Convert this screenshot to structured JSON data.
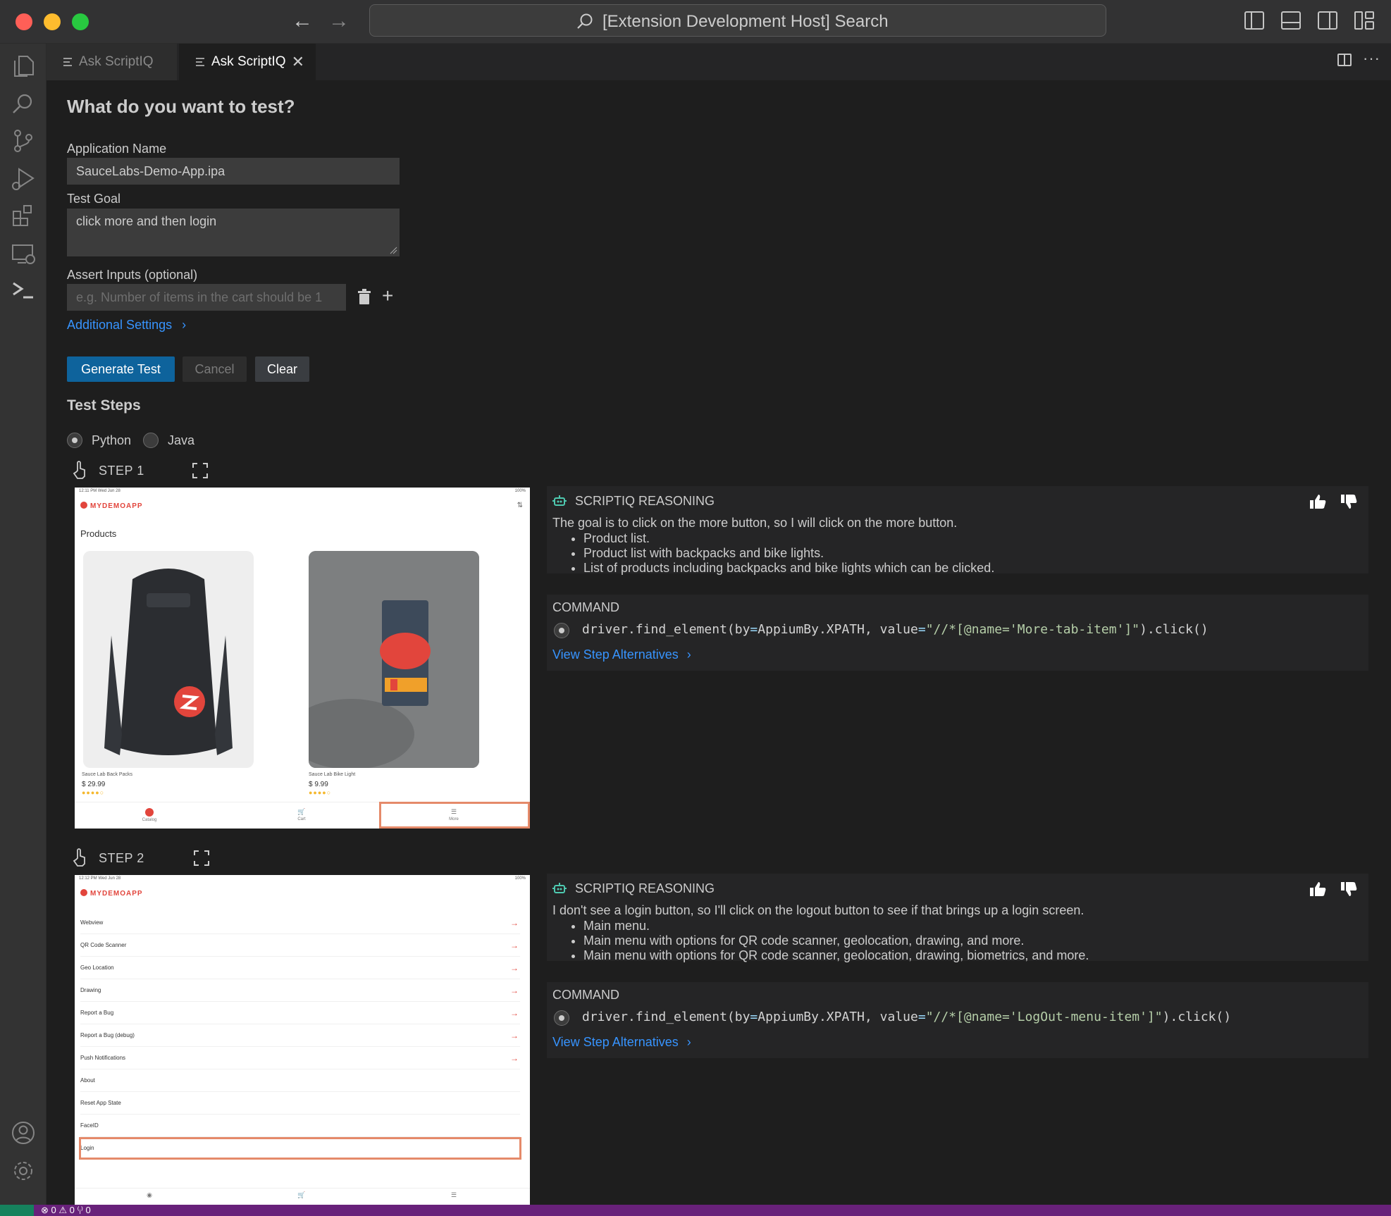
{
  "window": {
    "search_text": "[Extension Development Host] Search"
  },
  "tabs": [
    {
      "label": "Ask ScriptIQ"
    },
    {
      "label": "Ask ScriptIQ"
    }
  ],
  "form": {
    "title": "What do you want to test?",
    "app_name_label": "Application Name",
    "app_name_value": "SauceLabs-Demo-App.ipa",
    "test_goal_label": "Test Goal",
    "test_goal_value": "click more and then login",
    "assert_label": "Assert Inputs (optional)",
    "assert_placeholder": "e.g. Number of items in the cart should be 1",
    "additional_settings": "Additional Settings",
    "generate_button": "Generate Test",
    "cancel_button": "Cancel",
    "clear_button": "Clear"
  },
  "test_steps": {
    "title": "Test Steps",
    "languages": [
      {
        "label": "Python",
        "selected": true
      },
      {
        "label": "Java",
        "selected": false
      }
    ],
    "steps": [
      {
        "label": "STEP 1",
        "reasoning_title": "SCRIPTIQ REASONING",
        "reasoning_text": "The goal is to click on the more button, so I will click on the more button.",
        "bullets": [
          "Product list.",
          "Product list with backpacks and bike lights.",
          "List of products including backpacks and bike lights which can be clicked."
        ],
        "command_title": "COMMAND",
        "command_prefix": "driver.find_element(by",
        "command_eq": "=",
        "command_mid": "AppiumBy.XPATH, value",
        "command_str": "\"//*[@name='More-tab-item']\"",
        "command_suffix": ").click()",
        "alternatives": "View Step Alternatives",
        "screenshot": {
          "status_left": "12:11 PM   Wed Jun 28",
          "status_right": "100%",
          "logo": "MYDEMOAPP",
          "heading": "Products",
          "products": [
            {
              "name": "Sauce Lab Back Packs",
              "price": "$ 29.99",
              "stars": "●●●●○"
            },
            {
              "name": "Sauce Lab Bike Light",
              "price": "$ 9.99",
              "stars": "●●●●○"
            }
          ],
          "tabs": [
            "Catalog",
            "Cart",
            "More"
          ]
        }
      },
      {
        "label": "STEP 2",
        "reasoning_title": "SCRIPTIQ REASONING",
        "reasoning_text": "I don't see a login button, so I'll click on the logout button to see if that brings up a login screen.",
        "bullets": [
          "Main menu.",
          "Main menu with options for QR code scanner, geolocation, drawing, and more.",
          "Main menu with options for QR code scanner, geolocation, drawing, biometrics, and more."
        ],
        "command_title": "COMMAND",
        "command_prefix": "driver.find_element(by",
        "command_eq": "=",
        "command_mid": "AppiumBy.XPATH, value",
        "command_str": "\"//*[@name='LogOut-menu-item']\"",
        "command_suffix": ").click()",
        "alternatives": "View Step Alternatives",
        "screenshot": {
          "status_left": "12:12 PM   Wed Jun 28",
          "status_right": "100%",
          "logo": "MYDEMOAPP",
          "menu": [
            "Webview",
            "QR Code Scanner",
            "Geo Location",
            "Drawing",
            "Report a Bug",
            "Report a Bug (debug)",
            "Push Notifications",
            "About",
            "Reset App State",
            "FaceID",
            "Login"
          ]
        }
      }
    ]
  },
  "statusbar": {
    "text": "⊗ 0  ⚠ 0    ⁽ᵢ⁾ 0"
  },
  "colors": {
    "accent": "#0e639c",
    "link": "#3794ff",
    "statusbar": "#68217a",
    "highlight": "#e58a6a"
  }
}
